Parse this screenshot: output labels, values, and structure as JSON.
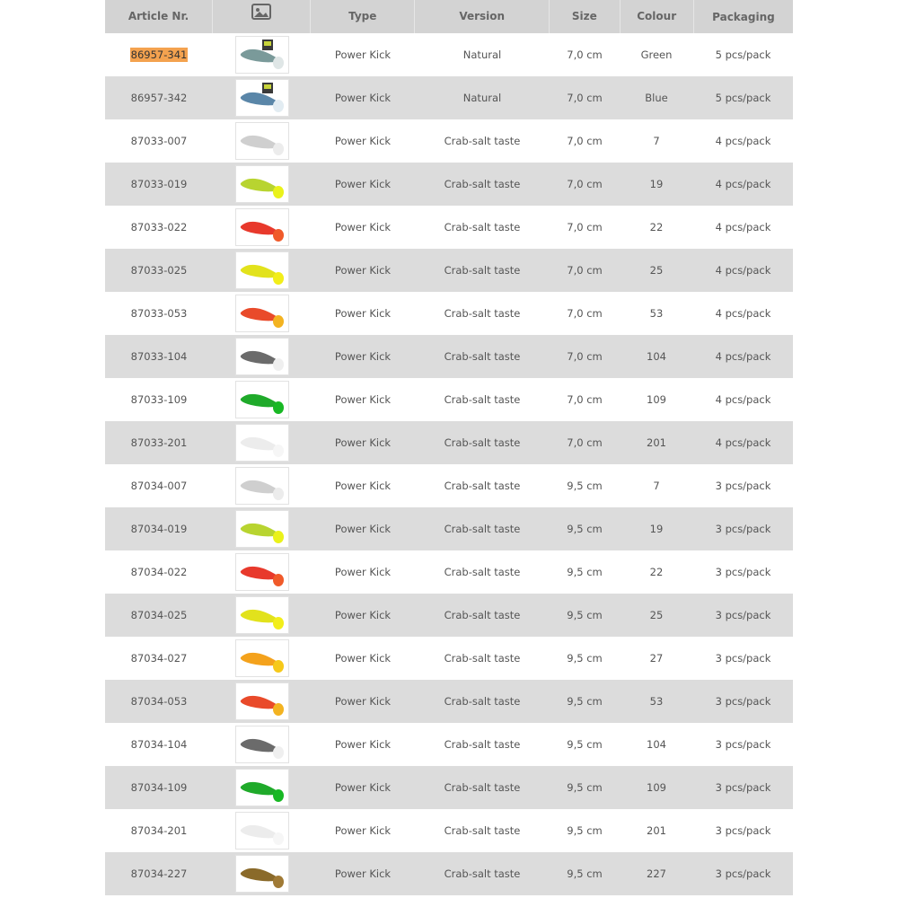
{
  "header": {
    "article": "Article Nr.",
    "image_icon": "image-icon",
    "type": "Type",
    "version": "Version",
    "size": "Size",
    "colour": "Colour",
    "packaging": "Packaging"
  },
  "highlight_color": "#f4a24f",
  "rows": [
    {
      "article": "86957-341",
      "type": "Power Kick",
      "version": "Natural",
      "size": "7,0 cm",
      "colour": "Green",
      "packaging": "5 pcs/pack",
      "body": "#7a9a9a",
      "tail": "#dfe6e6",
      "package": true
    },
    {
      "article": "86957-342",
      "type": "Power Kick",
      "version": "Natural",
      "size": "7,0 cm",
      "colour": "Blue",
      "packaging": "5 pcs/pack",
      "body": "#5a86a8",
      "tail": "#e2ecf2",
      "package": true
    },
    {
      "article": "87033-007",
      "type": "Power Kick",
      "version": "Crab-salt taste",
      "size": "7,0 cm",
      "colour": "7",
      "packaging": "4 pcs/pack",
      "body": "#cfcfcf",
      "tail": "#ececec"
    },
    {
      "article": "87033-019",
      "type": "Power Kick",
      "version": "Crab-salt taste",
      "size": "7,0 cm",
      "colour": "19",
      "packaging": "4 pcs/pack",
      "body": "#b8d430",
      "tail": "#eaf21a"
    },
    {
      "article": "87033-022",
      "type": "Power Kick",
      "version": "Crab-salt taste",
      "size": "7,0 cm",
      "colour": "22",
      "packaging": "4 pcs/pack",
      "body": "#e8392c",
      "tail": "#f05a2a"
    },
    {
      "article": "87033-025",
      "type": "Power Kick",
      "version": "Crab-salt taste",
      "size": "7,0 cm",
      "colour": "25",
      "packaging": "4 pcs/pack",
      "body": "#e2e21c",
      "tail": "#f2ee1a"
    },
    {
      "article": "87033-053",
      "type": "Power Kick",
      "version": "Crab-salt taste",
      "size": "7,0 cm",
      "colour": "53",
      "packaging": "4 pcs/pack",
      "body": "#e94a2a",
      "tail": "#f3b321"
    },
    {
      "article": "87033-104",
      "type": "Power Kick",
      "version": "Crab-salt taste",
      "size": "7,0 cm",
      "colour": "104",
      "packaging": "4 pcs/pack",
      "body": "#6b6b6b",
      "tail": "#efefef"
    },
    {
      "article": "87033-109",
      "type": "Power Kick",
      "version": "Crab-salt taste",
      "size": "7,0 cm",
      "colour": "109",
      "packaging": "4 pcs/pack",
      "body": "#1faa2a",
      "tail": "#18b824"
    },
    {
      "article": "87033-201",
      "type": "Power Kick",
      "version": "Crab-salt taste",
      "size": "7,0 cm",
      "colour": "201",
      "packaging": "4 pcs/pack",
      "body": "#ececec",
      "tail": "#f6f6f6"
    },
    {
      "article": "87034-007",
      "type": "Power Kick",
      "version": "Crab-salt taste",
      "size": "9,5 cm",
      "colour": "7",
      "packaging": "3 pcs/pack",
      "body": "#cfcfcf",
      "tail": "#ececec"
    },
    {
      "article": "87034-019",
      "type": "Power Kick",
      "version": "Crab-salt taste",
      "size": "9,5 cm",
      "colour": "19",
      "packaging": "3 pcs/pack",
      "body": "#b8d430",
      "tail": "#eaf21a"
    },
    {
      "article": "87034-022",
      "type": "Power Kick",
      "version": "Crab-salt taste",
      "size": "9,5 cm",
      "colour": "22",
      "packaging": "3 pcs/pack",
      "body": "#e8392c",
      "tail": "#f05a2a"
    },
    {
      "article": "87034-025",
      "type": "Power Kick",
      "version": "Crab-salt taste",
      "size": "9,5 cm",
      "colour": "25",
      "packaging": "3 pcs/pack",
      "body": "#e2e21c",
      "tail": "#f2ee1a"
    },
    {
      "article": "87034-027",
      "type": "Power Kick",
      "version": "Crab-salt taste",
      "size": "9,5 cm",
      "colour": "27",
      "packaging": "3 pcs/pack",
      "body": "#f4a21c",
      "tail": "#f6c91a"
    },
    {
      "article": "87034-053",
      "type": "Power Kick",
      "version": "Crab-salt taste",
      "size": "9,5 cm",
      "colour": "53",
      "packaging": "3 pcs/pack",
      "body": "#e94a2a",
      "tail": "#f3b321"
    },
    {
      "article": "87034-104",
      "type": "Power Kick",
      "version": "Crab-salt taste",
      "size": "9,5 cm",
      "colour": "104",
      "packaging": "3 pcs/pack",
      "body": "#6b6b6b",
      "tail": "#efefef"
    },
    {
      "article": "87034-109",
      "type": "Power Kick",
      "version": "Crab-salt taste",
      "size": "9,5 cm",
      "colour": "109",
      "packaging": "3 pcs/pack",
      "body": "#1faa2a",
      "tail": "#18b824"
    },
    {
      "article": "87034-201",
      "type": "Power Kick",
      "version": "Crab-salt taste",
      "size": "9,5 cm",
      "colour": "201",
      "packaging": "3 pcs/pack",
      "body": "#ececec",
      "tail": "#f6f6f6"
    },
    {
      "article": "87034-227",
      "type": "Power Kick",
      "version": "Crab-salt taste",
      "size": "9,5 cm",
      "colour": "227",
      "packaging": "3 pcs/pack",
      "body": "#8a6a2a",
      "tail": "#a07a35"
    }
  ]
}
